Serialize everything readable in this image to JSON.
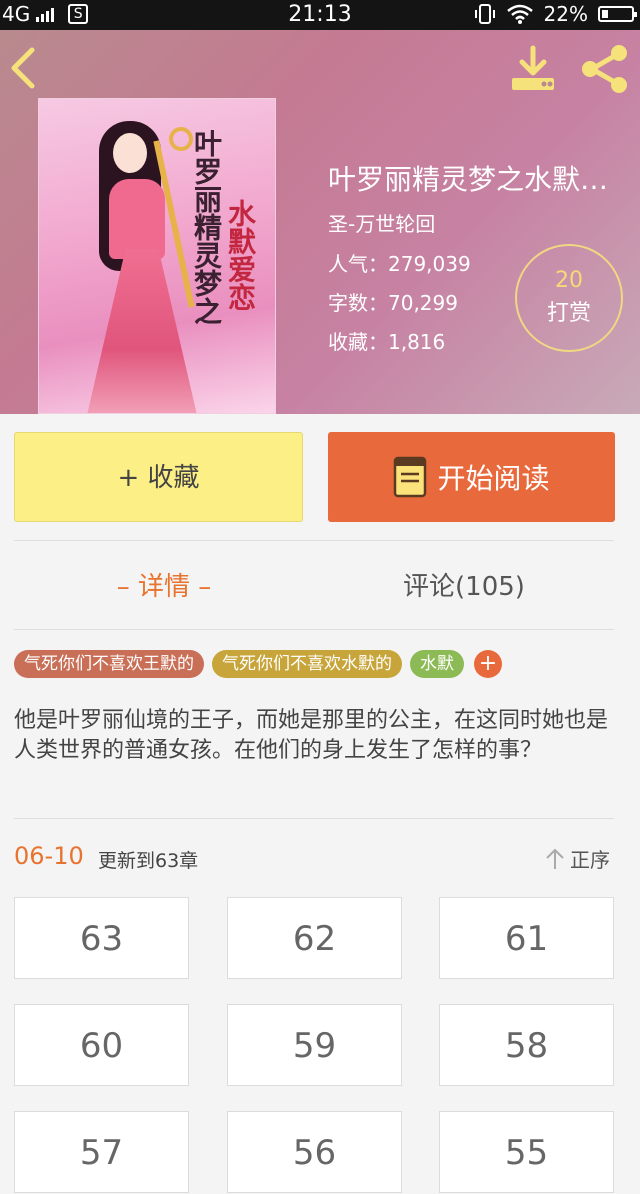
{
  "status_bar": {
    "network": "4G",
    "sim_label": "S",
    "time": "21:13",
    "battery": "22%"
  },
  "header": {
    "back_icon": "back-icon",
    "download_icon": "download-icon",
    "share_icon": "share-icon"
  },
  "cover": {
    "vertical_text_1": "叶罗丽精灵梦之",
    "vertical_text_2": "水默爱恋"
  },
  "book": {
    "title": "叶罗丽精灵梦之水默爱恋",
    "author": "圣-万世轮回",
    "popularity": "人气：279,039",
    "word_count": "字数：70,299",
    "favorites": "收藏：1,816"
  },
  "reward": {
    "count": "20",
    "label": "打赏"
  },
  "actions": {
    "favorite_label": "+ 收藏",
    "read_label": "开始阅读"
  },
  "tabs": {
    "detail": "– 详情 –",
    "comments": "评论(105)"
  },
  "tags": [
    "气死你们不喜欢王默的",
    "气死你们不喜欢水默的",
    "水默"
  ],
  "tag_add_label": "+",
  "description": "他是叶罗丽仙境的王子，而她是那里的公主，在这同时她也是人类世界的普通女孩。在他们的身上发生了怎样的事？",
  "update": {
    "date": "06-10",
    "text": "更新到63章",
    "sort_label": "正序"
  },
  "chapters": [
    "63",
    "62",
    "61",
    "60",
    "59",
    "58",
    "57",
    "56",
    "55"
  ],
  "colors": {
    "accent": "#e8693c",
    "favorite_button": "#fbef86"
  }
}
